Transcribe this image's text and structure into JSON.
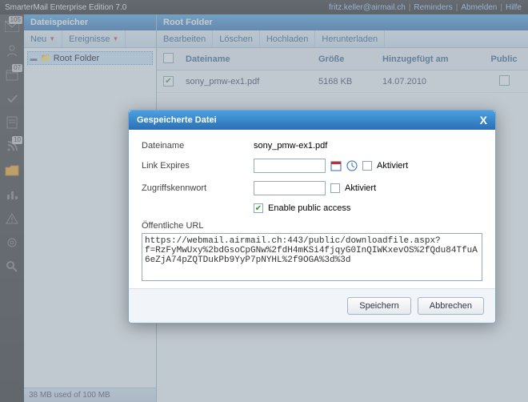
{
  "topbar": {
    "title": "SmarterMail Enterprise Edition 7.0",
    "user": "fritz.keller@airmail.ch",
    "links": {
      "reminders": "Reminders",
      "logout": "Abmelden",
      "help": "Hilfe"
    }
  },
  "sidebar": {
    "mail_badge": "105",
    "cal_badge": "07",
    "rss_badge": "10"
  },
  "left": {
    "title": "Dateispeicher",
    "new": "Neu",
    "events": "Ereignisse",
    "root_folder": "Root Folder"
  },
  "content": {
    "title": "Root Folder",
    "toolbar": {
      "edit": "Bearbeiten",
      "delete": "Löschen",
      "upload": "Hochladen",
      "download": "Herunterladen"
    },
    "columns": {
      "name": "Dateiname",
      "size": "Größe",
      "date": "Hinzugefügt am",
      "public": "Public"
    },
    "rows": [
      {
        "name": "sony_pmw-ex1.pdf",
        "size": "5168 KB",
        "date": "14.07.2010",
        "checked": true,
        "public": false
      }
    ],
    "status": "38 MB used of 100 MB"
  },
  "dialog": {
    "title": "Gespeicherte Datei",
    "labels": {
      "filename": "Dateiname",
      "link_expires": "Link Expires",
      "password": "Zugriffskennwort",
      "activated": "Aktiviert",
      "enable_public": "Enable public access",
      "public_url": "Öffentliche URL"
    },
    "values": {
      "filename": "sony_pmw-ex1.pdf",
      "link_expires": "",
      "password": "",
      "enable_public_checked": true,
      "url": "https://webmail.airmail.ch:443/public/downloadfile.aspx?f=RzFyMwUxy%2bdGsoCpGNw%2fdH4mKSi4fjqyG0InQIWKxevOS%2fQdu84TfuA6eZjA74pZQTDukPb9YyP7pNYHL%2f9OGA%3d%3d"
    },
    "buttons": {
      "save": "Speichern",
      "cancel": "Abbrechen"
    }
  }
}
